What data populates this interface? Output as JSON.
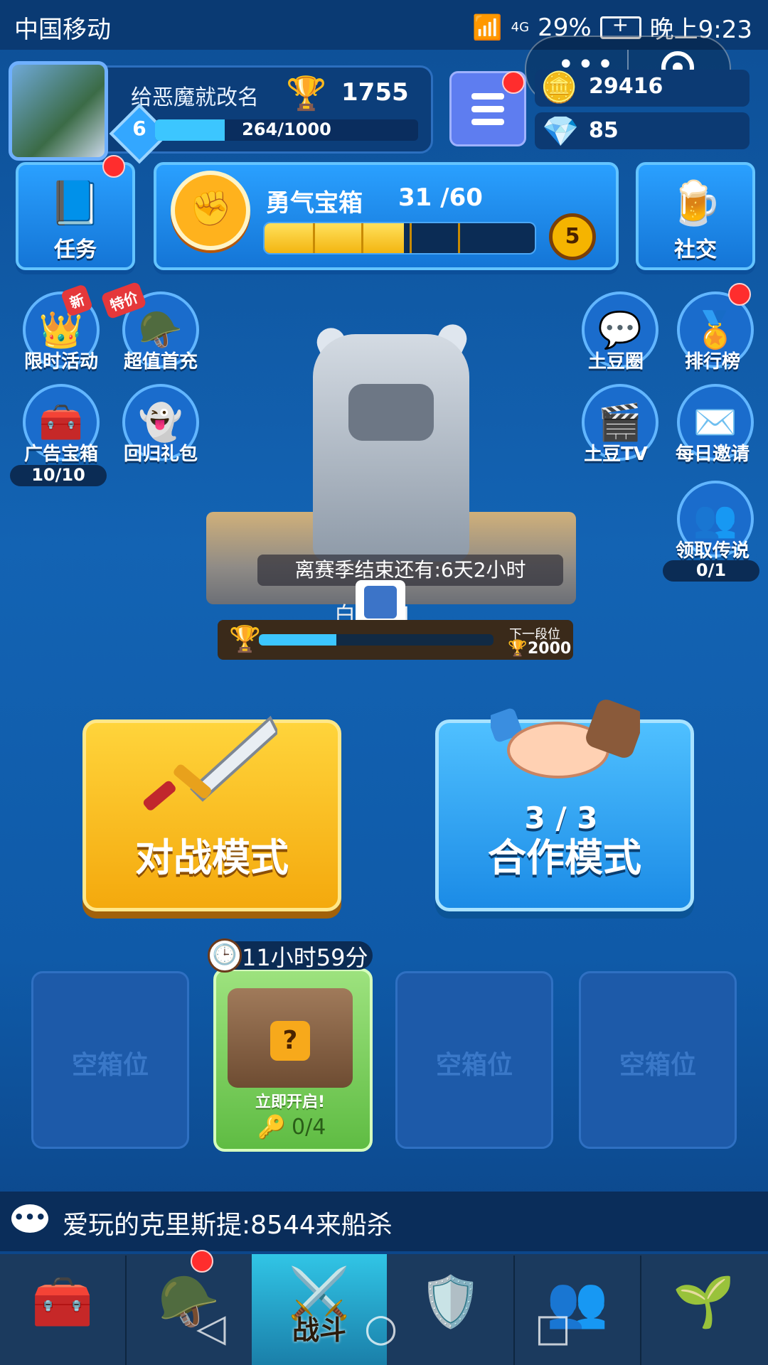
{
  "status_bar": {
    "carrier": "中国移动",
    "signal": "4G",
    "battery": "29%",
    "time": "晚上9:23"
  },
  "player": {
    "name": "给恶魔就改名",
    "trophies": "1755",
    "level": "6",
    "xp_text": "264/1000",
    "xp_fraction": 0.264
  },
  "currency": {
    "coins": "29416",
    "gems": "85"
  },
  "top_buttons": {
    "task": "任务",
    "social": "社交"
  },
  "chest_progress": {
    "title": "勇气宝箱",
    "count": "31 /60",
    "fraction": 0.517,
    "badge": "5"
  },
  "left_icons": [
    {
      "label": "限时活动",
      "tag": "新"
    },
    {
      "label": "超值首充",
      "tag": "特价"
    },
    {
      "label": "广告宝箱",
      "count": "10/10"
    },
    {
      "label": "回归礼包"
    }
  ],
  "right_icons": [
    {
      "label": "土豆圈"
    },
    {
      "label": "排行榜"
    },
    {
      "label": "土豆TV"
    },
    {
      "label": "每日邀请"
    },
    {
      "label": "领取传说",
      "count": "0/1"
    }
  ],
  "arena": {
    "season_text": "离赛季结束还有:6天2小时",
    "rank_name": "白 士 III",
    "next_label": "下一段位",
    "next_value": "2000",
    "rank_fraction": 0.33
  },
  "modes": {
    "battle": "对战模式",
    "coop": "合作模式",
    "coop_count": "3 / 3"
  },
  "slots": {
    "empty_label": "空箱位",
    "timer": "11小时59分",
    "open_label": "立即开启!",
    "keys": "0/4"
  },
  "chat": {
    "text": "爱玩的克里斯提:8544来船杀"
  },
  "nav": {
    "active_label": "战斗"
  },
  "colors": {
    "accent": "#1475d6",
    "gold": "#ffc21d",
    "battle": "#f4a90d"
  }
}
